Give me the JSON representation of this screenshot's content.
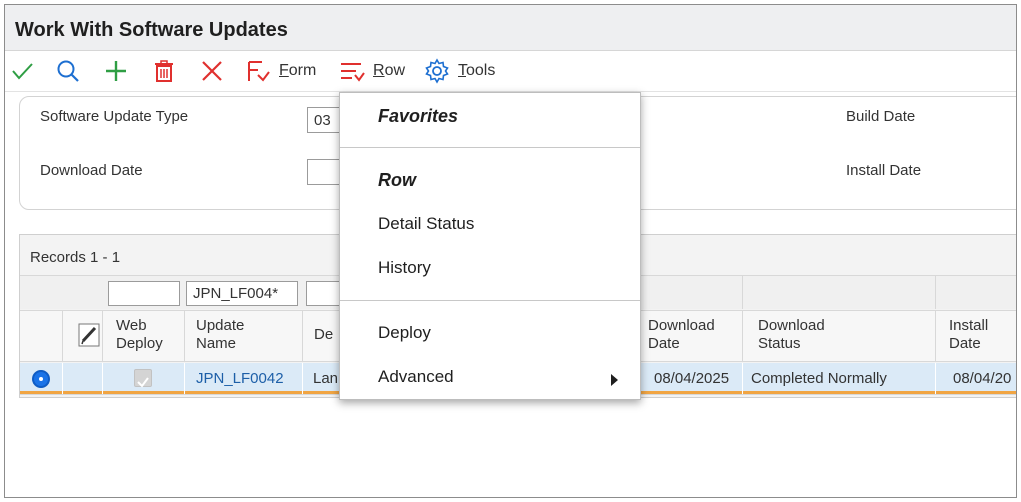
{
  "window": {
    "title": "Work With Software Updates"
  },
  "toolbar": {
    "form_label": "Form",
    "row_label": "Row",
    "tools_label": "Tools",
    "icons": [
      "checkmark-icon",
      "search-icon",
      "add-icon",
      "delete-icon",
      "cancel-icon",
      "form-icon",
      "row-icon",
      "tools-gear-icon"
    ],
    "colors": {
      "ok": "#2f9e44",
      "blue": "#1d6fd1",
      "red": "#e0302e"
    }
  },
  "search": {
    "software_update_type_label": "Software Update Type",
    "software_update_type_value": "03",
    "download_date_label": "Download Date",
    "download_date_value": "",
    "build_date_label": "Build Date",
    "install_date_label": "Install Date"
  },
  "grid": {
    "records_label": "Records 1 - 1",
    "filter_update_name": "JPN_LF004*",
    "columns": {
      "web_deploy": "Web\nDeploy",
      "update_name": "Update\nName",
      "description": "De",
      "download_date": "Download\nDate",
      "download_status": "Download\nStatus",
      "install_date": "Install\nDate"
    },
    "rows": [
      {
        "update_name": "JPN_LF0042",
        "description": "Lan",
        "download_date": "08/04/2025",
        "download_status": "Completed Normally",
        "install_date": "08/04/20"
      }
    ]
  },
  "popup_menu": {
    "favorites_header": "Favorites",
    "row_header": "Row",
    "items": [
      "Detail Status",
      "History"
    ],
    "lower_items": [
      "Deploy",
      "Advanced"
    ]
  }
}
